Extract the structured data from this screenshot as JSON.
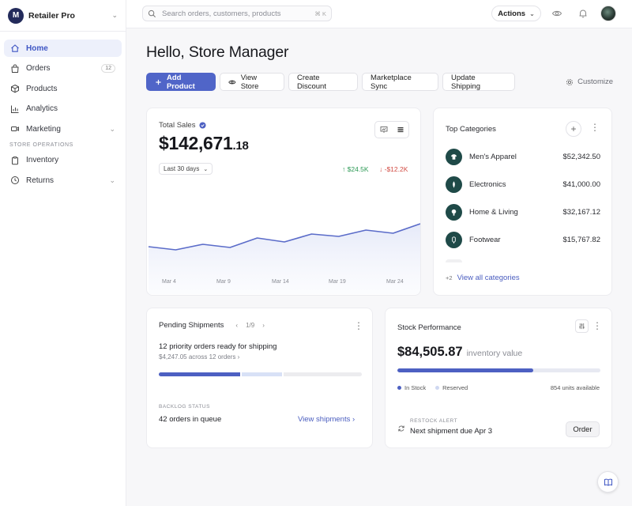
{
  "brand": {
    "initial": "M",
    "name": "Retailer Pro"
  },
  "sidebar": {
    "items": [
      {
        "label": "Home",
        "icon": "home-icon",
        "active": true
      },
      {
        "label": "Orders",
        "icon": "bag-icon",
        "badge": "12"
      },
      {
        "label": "Products",
        "icon": "box-icon"
      },
      {
        "label": "Analytics",
        "icon": "chart-icon"
      },
      {
        "label": "Marketing",
        "icon": "video-icon",
        "expandable": true
      }
    ],
    "section_label": "STORE OPERATIONS",
    "section_items": [
      {
        "label": "Inventory",
        "icon": "clipboard-icon"
      },
      {
        "label": "Returns",
        "icon": "clock-icon",
        "expandable": true
      }
    ]
  },
  "topbar": {
    "search_placeholder": "Search orders, customers, products",
    "search_shortcut": "⌘ K",
    "actions_label": "Actions"
  },
  "greeting": "Hello, Store Manager",
  "toolbar": {
    "add_product": "Add Product",
    "view_store": "View Store",
    "create_discount": "Create Discount",
    "marketplace_sync": "Marketplace Sync",
    "update_shipping": "Update Shipping",
    "customize": "Customize"
  },
  "sales": {
    "label": "Total Sales",
    "amount_main": "$142,671",
    "amount_cents": ".18",
    "range": "Last 30 days",
    "delta_up": "↑ $24.5K",
    "delta_down": "↓ -$12.2K",
    "ticks": [
      "Mar 4",
      "Mar 9",
      "Mar 14",
      "Mar 19",
      "Mar 24"
    ]
  },
  "chart_data": {
    "type": "area",
    "x": [
      "Mar 2",
      "Mar 4",
      "Mar 7",
      "Mar 9",
      "Mar 12",
      "Mar 14",
      "Mar 17",
      "Mar 19",
      "Mar 22",
      "Mar 24",
      "Mar 27"
    ],
    "values": [
      35,
      31,
      38,
      34,
      46,
      41,
      51,
      48,
      56,
      52,
      64
    ],
    "ylim": [
      0,
      100
    ],
    "xlabel": "",
    "ylabel": "",
    "title": "",
    "line_color": "#5b6cc9"
  },
  "categories": {
    "title": "Top Categories",
    "items": [
      {
        "name": "Men's Apparel",
        "value": "$52,342.50",
        "icon": "shirt-icon"
      },
      {
        "name": "Electronics",
        "value": "$41,000.00",
        "icon": "device-icon"
      },
      {
        "name": "Home & Living",
        "value": "$32,167.12",
        "icon": "lamp-icon"
      },
      {
        "name": "Footwear",
        "value": "$15,767.82",
        "icon": "shoe-icon"
      }
    ],
    "more_count": "+2",
    "view_all": "View all categories"
  },
  "shipments": {
    "title": "Pending Shipments",
    "pager": "1/9",
    "headline": "12 priority orders ready for shipping",
    "sub": "$4,247.05 across 12 orders",
    "progress_primary": 0.4,
    "progress_secondary": 0.2,
    "backlog_label": "BACKLOG STATUS",
    "backlog_value": "42 orders in queue",
    "view_link": "View shipments"
  },
  "stock": {
    "title": "Stock Performance",
    "amount": "$84,505.87",
    "amount_unit": "inventory value",
    "fill": 0.67,
    "legend_in_stock": "In Stock",
    "legend_reserved": "Reserved",
    "units_available": "854 units available",
    "restock_label": "RESTOCK ALERT",
    "restock_text": "Next shipment due Apr 3",
    "order_label": "Order"
  },
  "colors": {
    "accent": "#5065c8",
    "positive": "#2d9a56",
    "negative": "#d24c44",
    "category_icon_bg": "#1f4a48"
  }
}
